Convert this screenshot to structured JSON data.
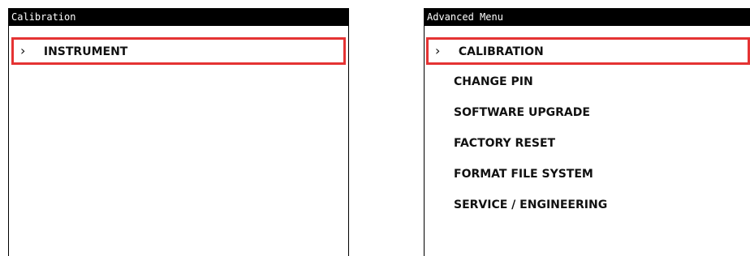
{
  "left_screen": {
    "title": "Calibration",
    "items": [
      {
        "label": "INSTRUMENT",
        "selected": true
      }
    ]
  },
  "right_screen": {
    "title": "Advanced Menu",
    "items": [
      {
        "label": "CALIBRATION",
        "selected": true
      },
      {
        "label": "CHANGE PIN",
        "selected": false
      },
      {
        "label": "SOFTWARE UPGRADE",
        "selected": false
      },
      {
        "label": "FACTORY RESET",
        "selected": false
      },
      {
        "label": "FORMAT FILE SYSTEM",
        "selected": false
      },
      {
        "label": "SERVICE / ENGINEERING",
        "selected": false
      }
    ]
  },
  "selection_glyph": "›",
  "colors": {
    "title_bar": "#000000",
    "selection_outline": "#e53333",
    "text": "#111111"
  },
  "icons": {
    "selection": "chevron-right-icon"
  }
}
